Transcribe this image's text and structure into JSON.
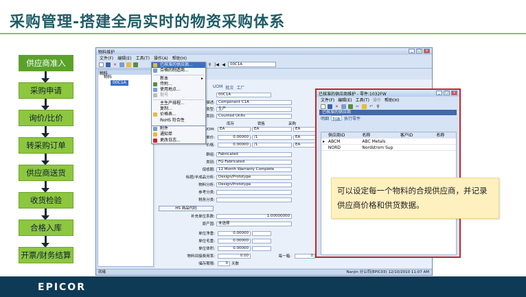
{
  "slide": {
    "title": "采购管理-搭建全局实时的物资采购体系",
    "steps": [
      "供应商准入",
      "采购申请",
      "询价/比价",
      "转采购订单",
      "供应商送货",
      "收货检验",
      "合格入库",
      "开票/财务结算"
    ],
    "logo": "EPICOR",
    "callout": "可以设定每一个物料的合规供应商，并记录供应商价格和供货数据。"
  },
  "main_window": {
    "title": "物料维护",
    "menu": [
      "文件(F)",
      "编辑(E)",
      "工具(T)",
      "操作(A)",
      "帮助(H)"
    ],
    "part_id": "00C1A",
    "tree_header": "物料",
    "tree_root": "物料",
    "tree_child": "00C1A",
    "tabs": [
      "UOM",
      "批次",
      "工厂"
    ],
    "fields": {
      "part": "00C1A",
      "desc_label": "描述:",
      "desc": "Component C1A",
      "type_label": "类型:",
      "type": "生产",
      "uom_class_label": "类别:",
      "uom_class": "Counted Units",
      "col_headers": [
        "库存",
        "销售",
        "采购"
      ],
      "uom_label": "UOM:",
      "uoms": [
        "EA",
        "EA",
        "EA"
      ],
      "price_label": "单价:",
      "price": "0.00000",
      "per": "/1",
      "cost_label": "价格:",
      "cost": "0.00000",
      "group_label": "群组:",
      "group": "Fabricated",
      "class_label": "类别:",
      "class": "FG-Fabricated",
      "warranty_label": "保修期:",
      "warranty": "12 Month Warranty Complete",
      "analysis1_label": "标题/半成品分析:",
      "analysis1": "Design/Prototype",
      "analysis2_label": "物料分析:",
      "analysis2": "Design/Prototype",
      "ref_label": "参考分类:",
      "tax_label": "税务分类:",
      "hs_button": "HS 商品代码",
      "factor_label": "补充单位系数:",
      "factor": "1.00000000",
      "origin_label": "原产国:",
      "origin": "未选择",
      "net_label": "单位净重:",
      "net": "0.00000",
      "gross_label": "单位毛重:",
      "gross": "0.00000",
      "vol_label": "单位体积:",
      "vol": "0.00000",
      "usage_label": "物料间接费用率:",
      "usage": "0.00",
      "each_label": "每一箱:",
      "each": "0",
      "shelf_label": "储存期限:",
      "shelf": "0",
      "shelf_unit": "天数"
    },
    "status_left": "就绪",
    "status_right": "Nanjin 分公司(EPIC03)  12/10/2010  11:07 AM"
  },
  "context_menu": {
    "items": [
      "已核准的供应商...",
      "合格的制造商...",
      "新本",
      "传附...",
      "使用地点...",
      "批号",
      "主生产排程...",
      "复制...",
      "价格表...",
      "RoHS 符合性",
      "附件",
      "通知单",
      "更改日志..."
    ]
  },
  "popup": {
    "title": "已核准的供应商维护 - 零件:1032FW",
    "menu": [
      "文件(F)",
      "编辑(E)",
      "工具(T)",
      "操作",
      "帮助(H)"
    ],
    "header": "已核准的供应商",
    "tabs": [
      "明细",
      "列表",
      "执行零件"
    ],
    "columns": [
      "供应商ID",
      "名称",
      "客户ID",
      "名称"
    ],
    "rows": [
      {
        "id": "ABCM",
        "name": "ABC Metals"
      },
      {
        "id": "NORD",
        "name": "Nordstrom Sup"
      }
    ]
  }
}
